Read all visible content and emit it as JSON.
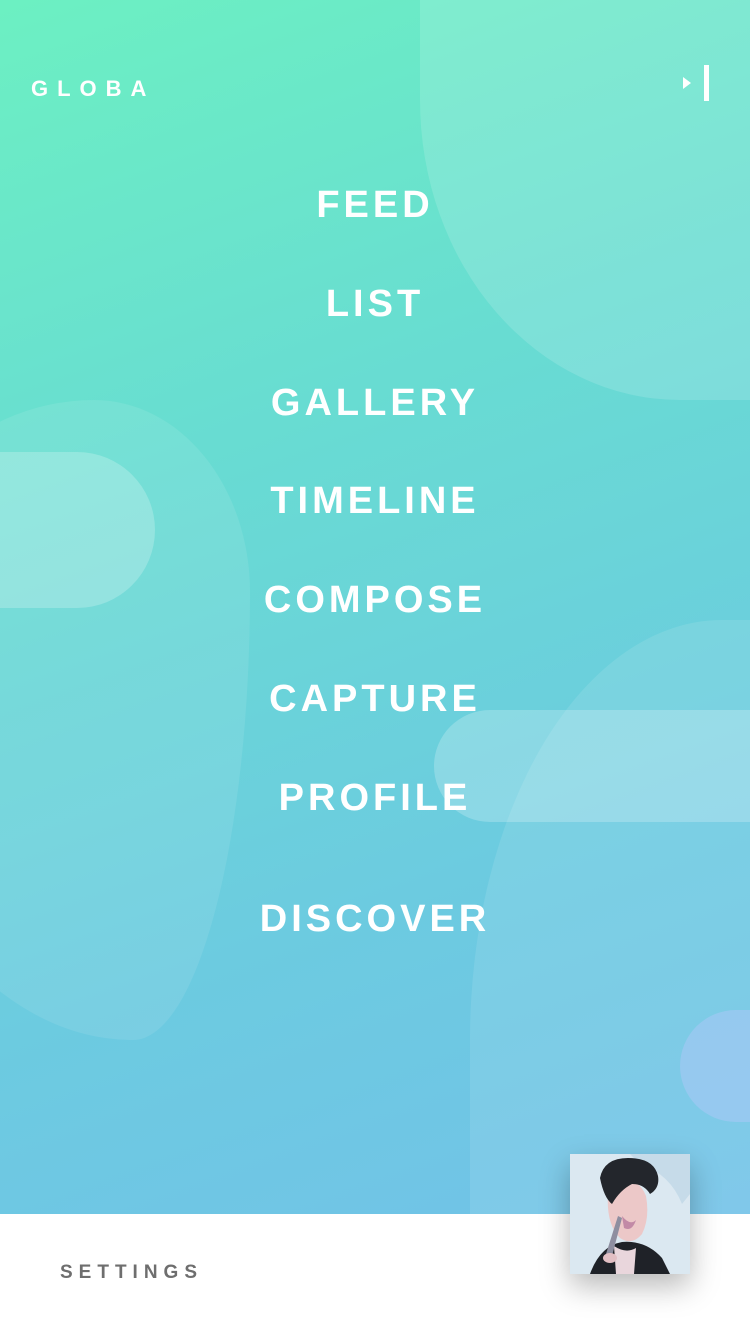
{
  "header": {
    "brand": "GLOBA",
    "collapse_icon": "collapse-menu-icon"
  },
  "menu": {
    "items": [
      {
        "label": "FEED"
      },
      {
        "label": "LIST"
      },
      {
        "label": "GALLERY"
      },
      {
        "label": "TIMELINE"
      },
      {
        "label": "COMPOSE"
      },
      {
        "label": "CAPTURE"
      },
      {
        "label": "PROFILE"
      },
      {
        "label": "DISCOVER"
      }
    ]
  },
  "footer": {
    "settings_label": "SETTINGS"
  },
  "colors": {
    "gradient_start": "#6cf0c2",
    "gradient_end": "#72c2e8",
    "menu_text": "#ffffff",
    "settings_text": "#6e6e6e",
    "footer_bg": "#ffffff"
  }
}
